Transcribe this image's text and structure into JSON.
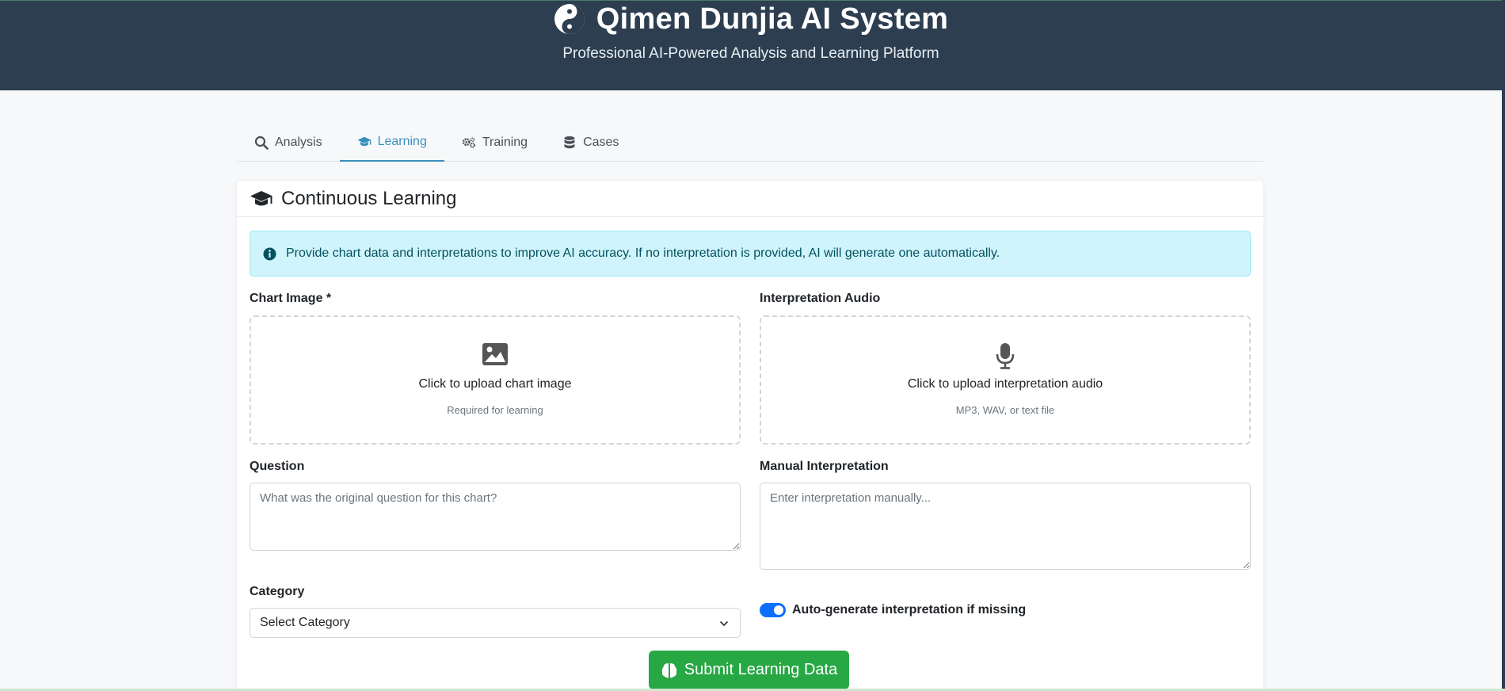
{
  "header": {
    "title": "Qimen Dunjia AI System",
    "subtitle": "Professional AI-Powered Analysis and Learning Platform",
    "logo_icon": "yin-yang-icon"
  },
  "tabs": [
    {
      "label": "Analysis",
      "icon": "search-icon",
      "active": false
    },
    {
      "label": "Learning",
      "icon": "graduation-cap-icon",
      "active": true
    },
    {
      "label": "Training",
      "icon": "gears-icon",
      "active": false
    },
    {
      "label": "Cases",
      "icon": "database-icon",
      "active": false
    }
  ],
  "card": {
    "title": "Continuous Learning",
    "alert": "Provide chart data and interpretations to improve AI accuracy. If no interpretation is provided, AI will generate one automatically."
  },
  "form": {
    "chart_image": {
      "label": "Chart Image *",
      "main": "Click to upload chart image",
      "sub": "Required for learning"
    },
    "audio": {
      "label": "Interpretation Audio",
      "main": "Click to upload interpretation audio",
      "sub": "MP3, WAV, or text file"
    },
    "question": {
      "label": "Question",
      "placeholder": "What was the original question for this chart?"
    },
    "manual": {
      "label": "Manual Interpretation",
      "placeholder": "Enter interpretation manually..."
    },
    "category": {
      "label": "Category",
      "selected": "Select Category"
    },
    "auto_generate": {
      "label": "Auto-generate interpretation if missing",
      "checked": true
    },
    "submit_label": "Submit Learning Data"
  },
  "colors": {
    "header_bg": "#2c3e50",
    "accent": "#3a8fbd",
    "submit": "#28a745",
    "alert_bg": "#cff4fc"
  }
}
